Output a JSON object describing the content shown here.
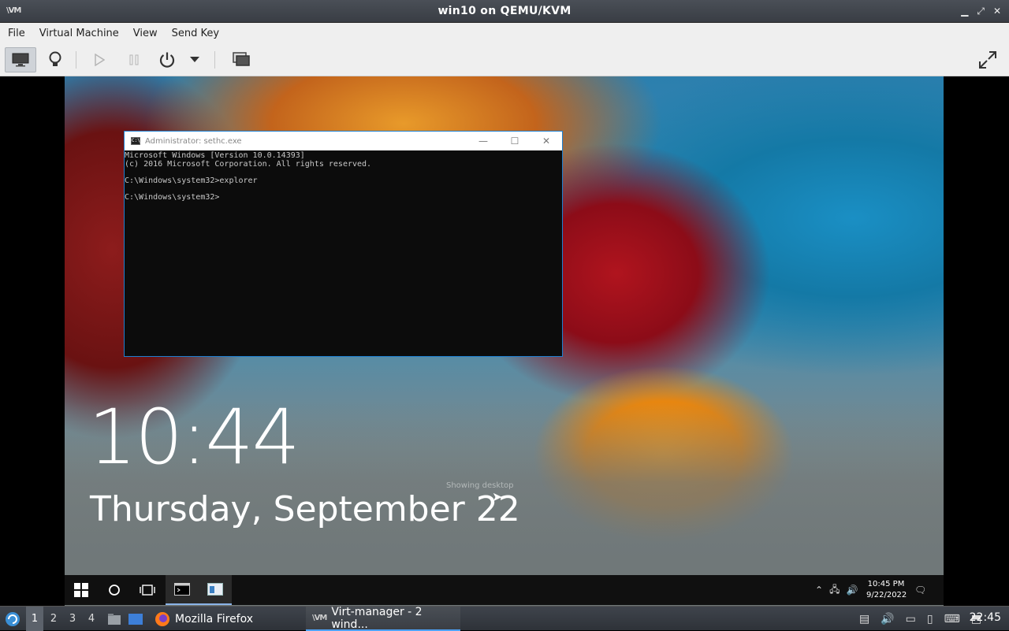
{
  "window": {
    "title": "win10 on QEMU/KVM",
    "app_icon": "\\VM"
  },
  "menu": [
    "File",
    "Virtual Machine",
    "View",
    "Send Key"
  ],
  "toolbar": {
    "icons": {
      "console": "monitor-icon",
      "details": "lightbulb-icon",
      "run": "play-icon",
      "pause": "pause-icon",
      "shutdown": "power-icon",
      "shutdown_menu": "chevron-down-icon",
      "snapshots": "snapshots-icon",
      "fullscreen": "fullscreen-icon"
    }
  },
  "guest": {
    "lock_time": "10:44",
    "lock_date": "Thursday, September 22",
    "showing_desktop": "Showing desktop",
    "cmd": {
      "title": "Administrator: sethc.exe",
      "lines": [
        "Microsoft Windows [Version 10.0.14393]",
        "(c) 2016 Microsoft Corporation. All rights reserved.",
        "",
        "C:\\Windows\\system32>explorer",
        "",
        "C:\\Windows\\system32>"
      ]
    },
    "taskbar": {
      "time": "10:45 PM",
      "date": "9/22/2022"
    }
  },
  "host_taskbar": {
    "workspaces": [
      "1",
      "2",
      "3",
      "4"
    ],
    "tasks": [
      {
        "label": "Mozilla Firefox"
      },
      {
        "label": "Virt-manager - 2 wind..."
      }
    ],
    "clock": "22:45"
  },
  "colors": {
    "accent": "#4da3ff",
    "cmd_border": "#1e7fd0"
  }
}
